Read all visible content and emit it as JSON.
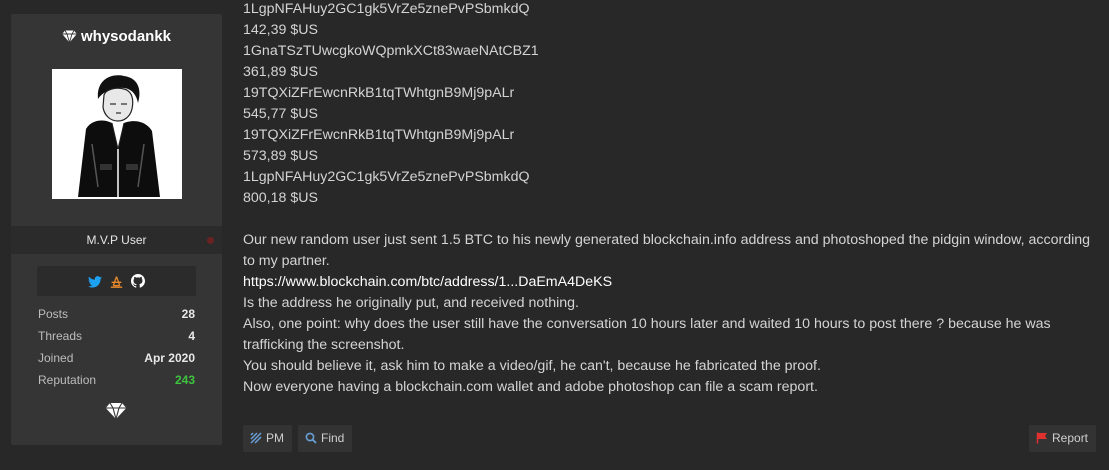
{
  "user": {
    "username": "whysodankk",
    "rank": "M.V.P User",
    "stats": [
      {
        "label": "Posts",
        "value": "28"
      },
      {
        "label": "Threads",
        "value": "4"
      },
      {
        "label": "Joined",
        "value": "Apr 2020"
      },
      {
        "label": "Reputation",
        "value": "243"
      }
    ],
    "social_icons": [
      "twitter-icon",
      "bitbucket-icon",
      "github-icon"
    ]
  },
  "post": {
    "lines_top": [
      "1LgpNFAHuy2GC1gk5VrZe5znePvPSbmkdQ",
      "142,39 $US",
      "1GnaTSzTUwcgkoWQpmkXCt83waeNAtCBZ1",
      "361,89 $US",
      "19TQXiZFrEwcnRkB1tqTWhtgnB9Mj9pALr",
      "545,77 $US",
      "19TQXiZFrEwcnRkB1tqTWhtgnB9Mj9pALr",
      "573,89 $US",
      "1LgpNFAHuy2GC1gk5VrZe5znePvPSbmkdQ",
      "800,18 $US"
    ],
    "paragraph": "Our new random user just sent 1.5 BTC to his newly generated blockchain.info address and photoshoped the pidgin window, according to my partner.",
    "link": "https://www.blockchain.com/btc/address/1...DaEmA4DeKS",
    "lines_bottom": [
      "Is the address he originally put, and received nothing.",
      "Also, one point: why does the user still have the conversation 10 hours later and waited 10 hours to post there ? because he was trafficking the screenshot.",
      "You should believe it, ask him to make a video/gif, he can't, because he fabricated the proof.",
      "Now everyone having a blockchain.com wallet and adobe photoshop can file a scam report."
    ]
  },
  "actions": {
    "pm": "PM",
    "find": "Find",
    "report": "Report"
  },
  "colors": {
    "background": "#282828",
    "panel": "#353535",
    "reputation_green": "#3ec43e",
    "report_red": "#e03030"
  }
}
